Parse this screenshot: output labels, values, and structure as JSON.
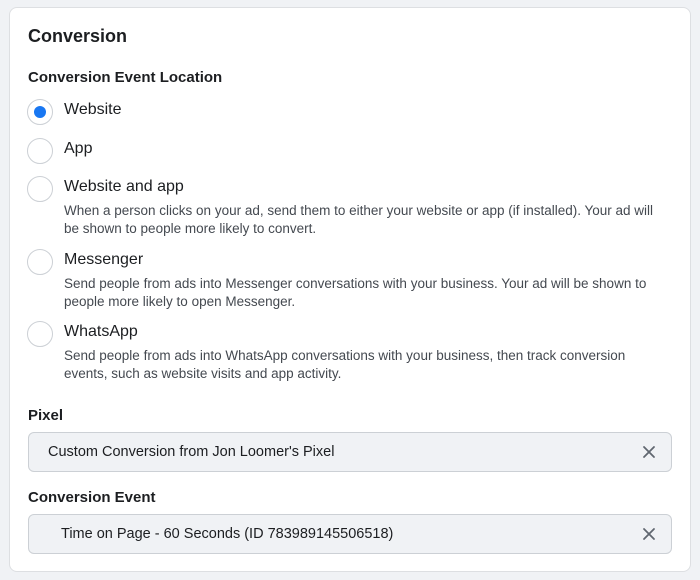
{
  "section": {
    "title": "Conversion",
    "location_label": "Conversion Event Location",
    "options": [
      {
        "label": "Website",
        "description": "",
        "selected": true
      },
      {
        "label": "App",
        "description": "",
        "selected": false
      },
      {
        "label": "Website and app",
        "description": "When a person clicks on your ad, send them to either your website or app (if installed). Your ad will be shown to people more likely to convert.",
        "selected": false
      },
      {
        "label": "Messenger",
        "description": "Send people from ads into Messenger conversations with your business. Your ad will be shown to people more likely to open Messenger.",
        "selected": false
      },
      {
        "label": "WhatsApp",
        "description": "Send people from ads into WhatsApp conversations with your business, then track conversion events, such as website visits and app activity.",
        "selected": false
      }
    ],
    "pixel_label": "Pixel",
    "pixel_value": "Custom Conversion from Jon Loomer's Pixel",
    "event_label": "Conversion Event",
    "event_value": "Time on Page - 60 Seconds (ID 783989145506518)"
  },
  "colors": {
    "accent": "#1877f2",
    "field_bg": "#f0f2f5"
  },
  "icons": {
    "clear": "close-icon"
  }
}
